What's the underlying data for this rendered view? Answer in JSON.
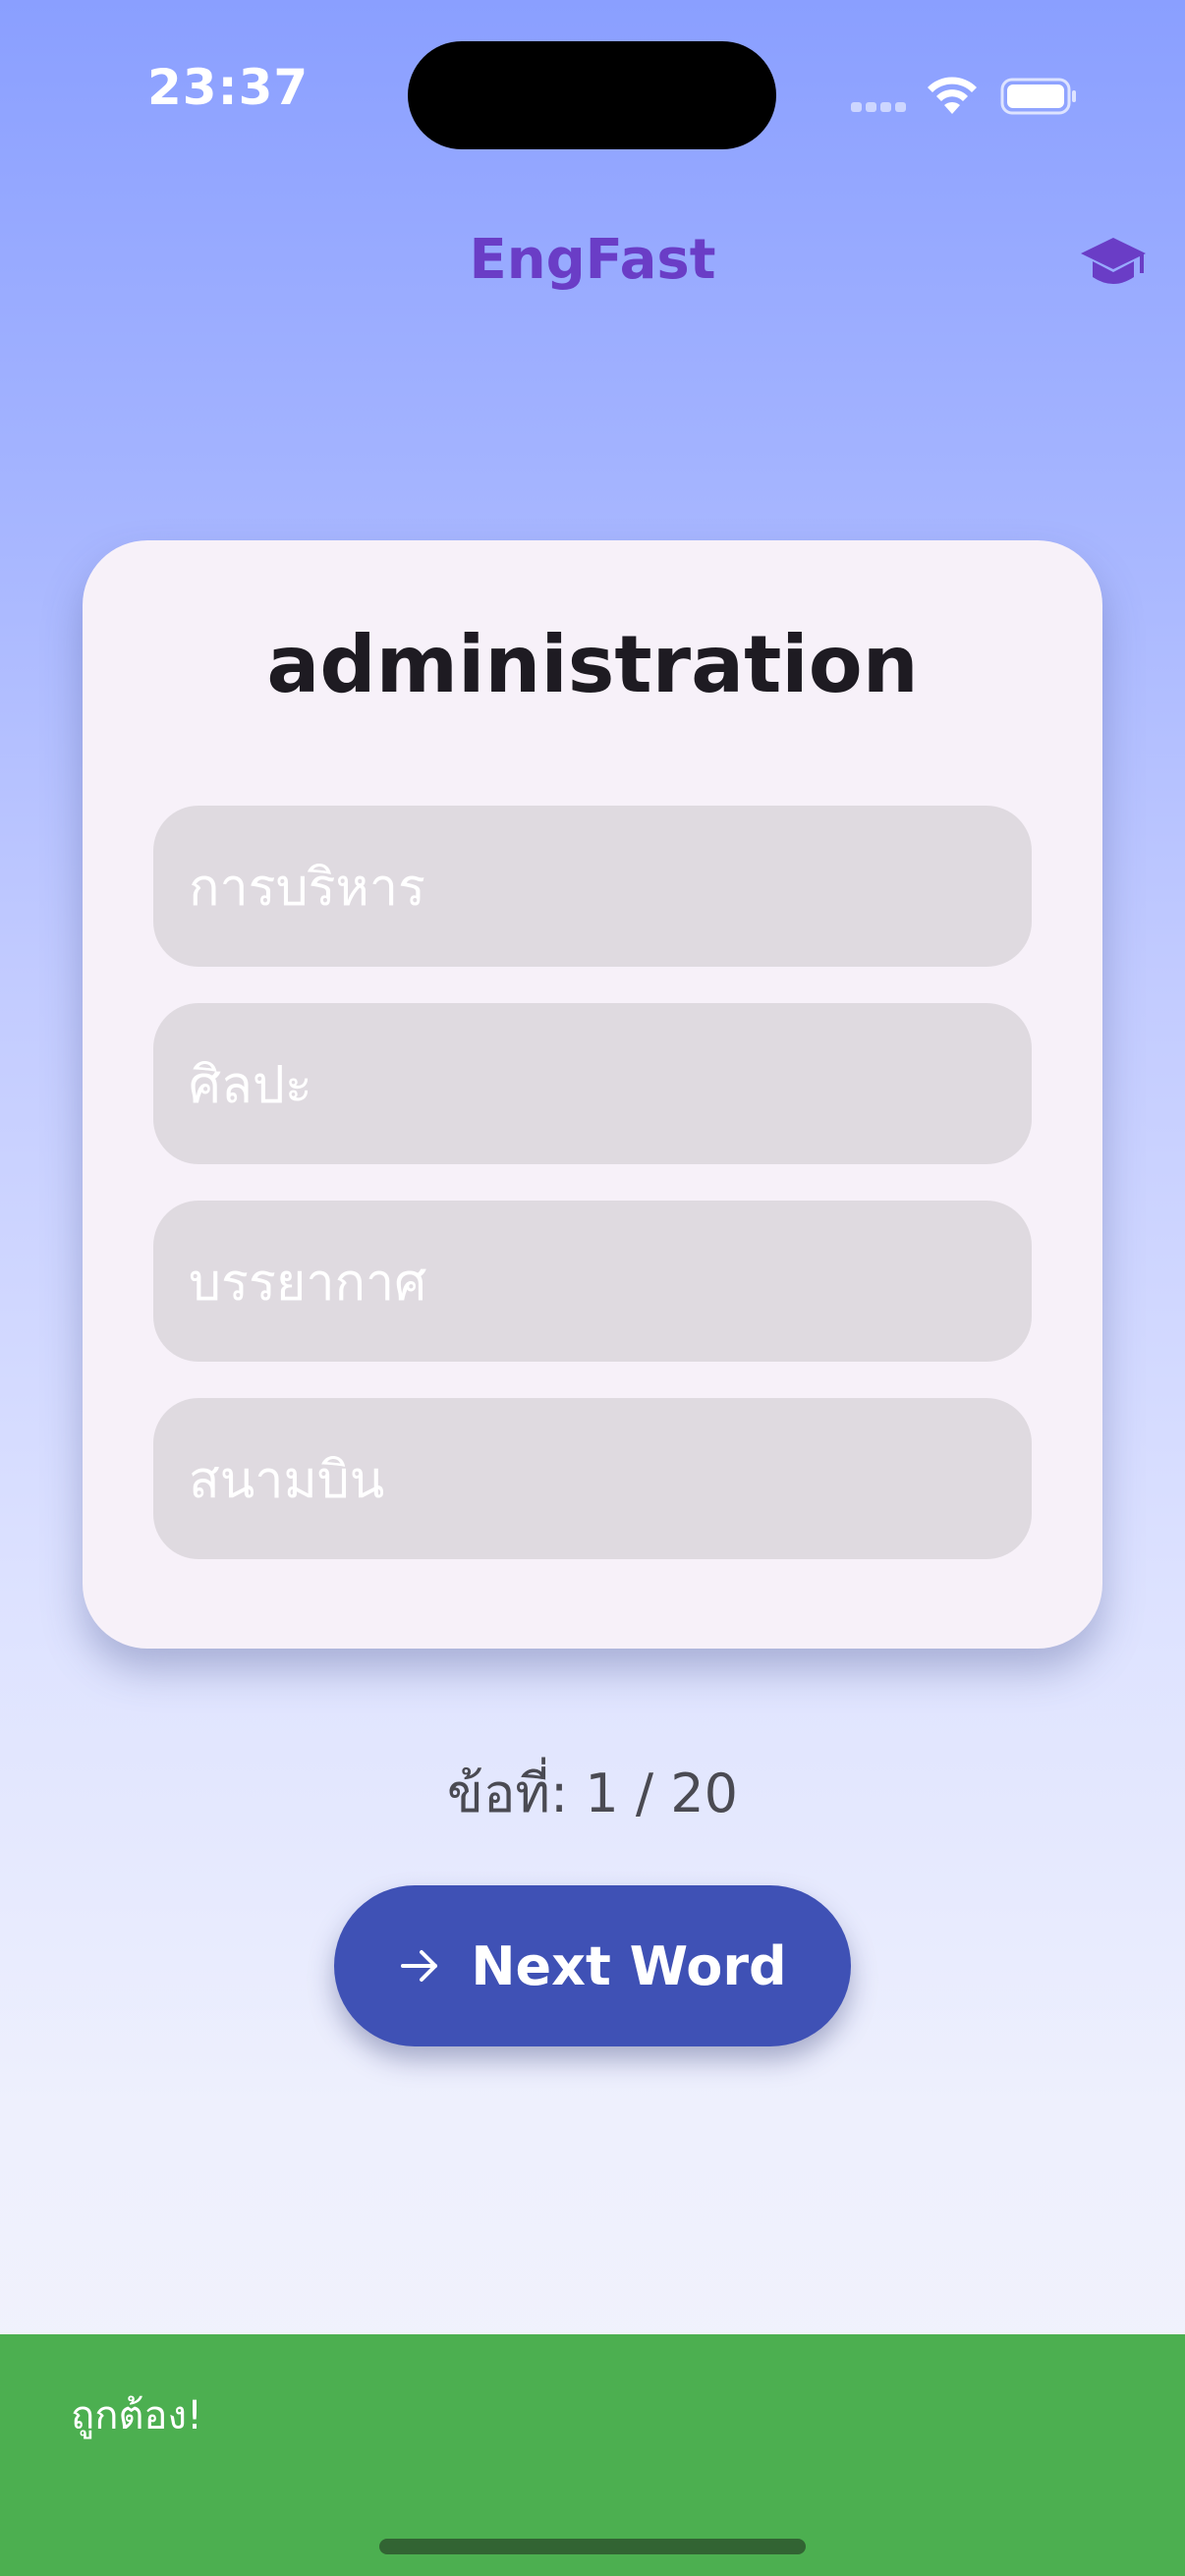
{
  "status_bar": {
    "time": "23:37"
  },
  "header": {
    "title": "EngFast",
    "right_icon": "graduation-cap-icon"
  },
  "quiz": {
    "word": "administration",
    "options": [
      "การบริหาร",
      "ศิลปะ",
      "บรรยากาศ",
      "สนามบิน"
    ]
  },
  "progress": {
    "text": "ข้อที่: 1 / 20",
    "current": 1,
    "total": 20
  },
  "next_button": {
    "label": "Next Word",
    "icon": "arrow-right-icon"
  },
  "snackbar": {
    "message": "ถูกต้อง!"
  },
  "colors": {
    "accent": "#6a3dc6",
    "button": "#3f51b5",
    "success": "#4caf50",
    "card": "#f7f1f9",
    "option": "#dfdae0"
  }
}
